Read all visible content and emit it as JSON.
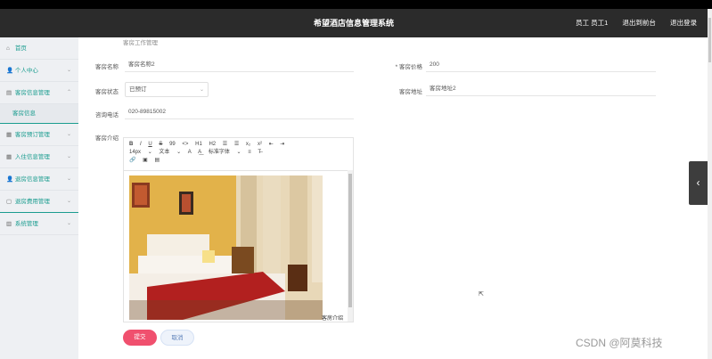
{
  "header": {
    "title": "希望酒店信息管理系统",
    "nav": [
      "员工 员工1",
      "退出到前台",
      "退出登录"
    ]
  },
  "sidebar": {
    "items": [
      {
        "icon": "home-icon",
        "glyph": "⌂",
        "label": "首页",
        "arrow": ""
      },
      {
        "icon": "person-icon",
        "glyph": "👤",
        "label": "个人中心",
        "arrow": "⌄"
      },
      {
        "icon": "list-icon",
        "glyph": "▤",
        "label": "客房信息管理",
        "arrow": "⌃"
      },
      {
        "icon": "",
        "glyph": "",
        "label": "客房信息",
        "arrow": "",
        "sub": true
      },
      {
        "icon": "calendar-icon",
        "glyph": "▦",
        "label": "客房预订管理",
        "arrow": "⌄"
      },
      {
        "icon": "calendar-icon",
        "glyph": "▦",
        "label": "入住信息管理",
        "arrow": "⌄"
      },
      {
        "icon": "person-icon",
        "glyph": "👤",
        "label": "退房信息管理",
        "arrow": "⌄"
      },
      {
        "icon": "doc-icon",
        "glyph": "▢",
        "label": "退房费用管理",
        "arrow": "⌄"
      },
      {
        "icon": "chart-icon",
        "glyph": "▥",
        "label": "系统管理",
        "arrow": "⌄"
      }
    ]
  },
  "form": {
    "cutoff_text": "客房工作管理",
    "room_name_label": "客房名称",
    "room_name_value": "客房名称2",
    "room_price_label": "* 客房价格",
    "room_price_value": "200",
    "room_status_label": "客房状态",
    "room_status_value": "已预订",
    "room_address_label": "客房地址",
    "room_address_value": "客房地址2",
    "phone_label": "咨询电话",
    "phone_value": "020-89815002",
    "intro_label": "客房介绍",
    "caption": "客房介绍"
  },
  "editor": {
    "toolbar_row1": [
      "B",
      "I",
      "U",
      "S",
      "99",
      "<>",
      "H1",
      "H2",
      "☰",
      "☰",
      "x₂",
      "x²",
      "⇤",
      "⇥"
    ],
    "toolbar_row2": [
      "14px",
      "⌄",
      "文本",
      "⌄",
      "A",
      "A͟",
      "标准字体",
      "⌄",
      "≡",
      "T̶"
    ],
    "toolbar_row3": [
      "🔗",
      "▣",
      "▤"
    ]
  },
  "buttons": {
    "submit": "提交",
    "cancel": "取消"
  },
  "float_panel": "‹",
  "watermark": "CSDN @阿莫科技"
}
